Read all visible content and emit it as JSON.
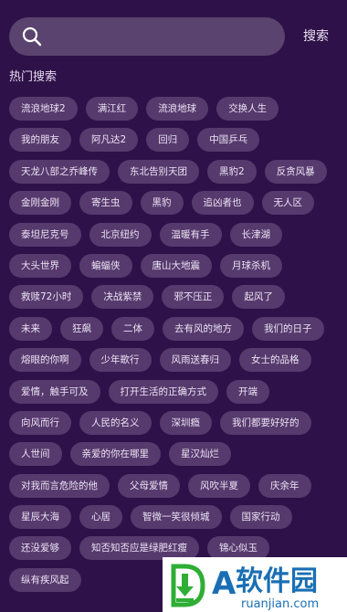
{
  "search": {
    "placeholder": "",
    "button_label": "搜索",
    "icon": "search-icon"
  },
  "hot": {
    "title": "热门搜索",
    "rows": [
      [
        "流浪地球2",
        "满江红",
        "流浪地球",
        "交换人生"
      ],
      [
        "我的朋友",
        "阿凡达2",
        "回归",
        "中国乒乓"
      ],
      [
        "天龙八部之乔峰传",
        "东北告别天团",
        "黑豹2",
        "反贪风暴"
      ],
      [
        "金刚金刚",
        "寄生虫",
        "黑豹",
        "追凶者也",
        "无人区"
      ],
      [
        "泰坦尼克号",
        "北京纽约",
        "温暖有手",
        "长津湖"
      ],
      [
        "大头世界",
        "蝙蝠侠",
        "唐山大地震",
        "月球杀机"
      ],
      [
        "救赎72小时",
        "决战紫禁",
        "邪不压正",
        "起风了"
      ],
      [
        "未来",
        "狂飙",
        "二体",
        "去有风的地方",
        "我们的日子"
      ],
      [
        "熔眼的你啊",
        "少年歌行",
        "风雨送春归",
        "女士的品格"
      ],
      [
        "爱情，触手可及",
        "打开生活的正确方式",
        "开端"
      ],
      [
        "向风而行",
        "人民的名义",
        "深圳瘾",
        "我们都要好好的"
      ],
      [
        "人世间",
        "亲爱的你在哪里",
        "星汉灿烂"
      ],
      [
        "对我而言危险的他",
        "父母爱情",
        "风吹半夏",
        "庆余年"
      ],
      [
        "星辰大海",
        "心居",
        "智微一笑很倾城",
        "国家行动"
      ],
      [
        "还没爱够",
        "知否知否应是绿肥红瘦",
        "锦心似玉"
      ],
      [
        "纵有疾风起"
      ]
    ]
  },
  "watermark": {
    "brand_text": "软件园",
    "brand_letter": "A",
    "url_text": "ruanjian.com",
    "colors": {
      "green": "#2fae35",
      "blue": "#1a6fb4"
    }
  },
  "colors": {
    "background": "#2e1148",
    "tag_background": "#56396d",
    "search_background": "#5b436f"
  }
}
